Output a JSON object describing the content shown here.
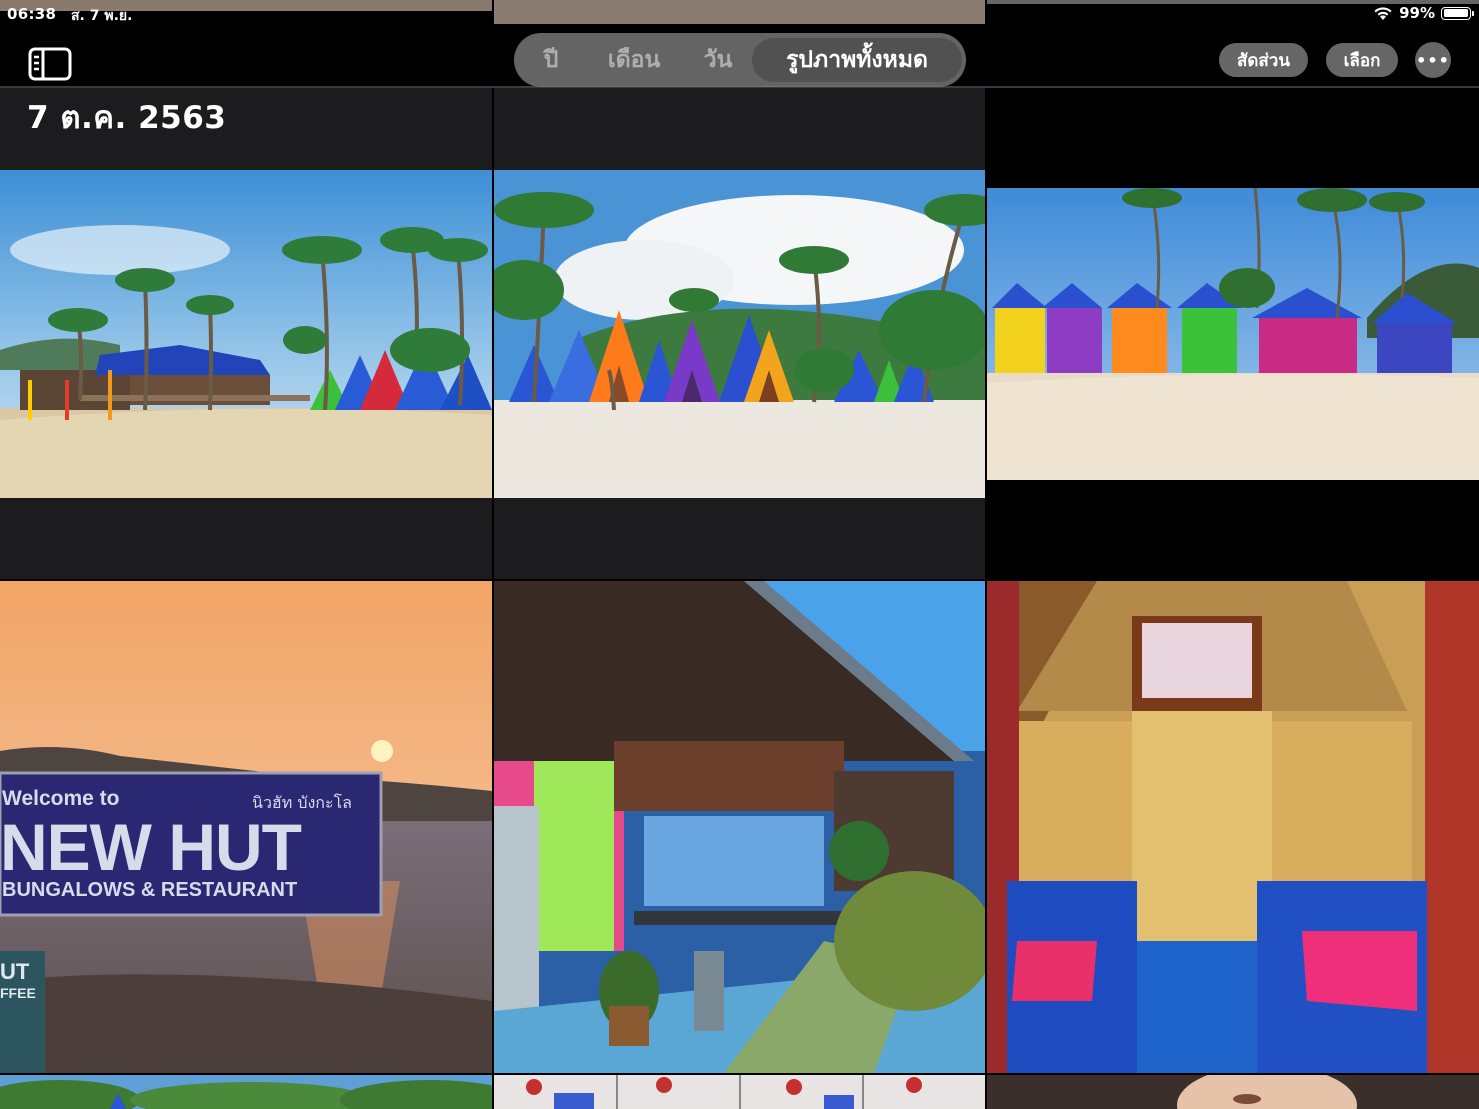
{
  "status_bar": {
    "time": "06:38",
    "date": "ส. 7 พ.ย.",
    "battery": "99%"
  },
  "toolbar": {
    "segments": [
      "ปี",
      "เดือน",
      "วัน",
      "รูปภาพทั้งหมด"
    ],
    "active_segment": "รูปภาพทั้งหมด",
    "aspect_label": "สัดส่วน",
    "select_label": "เลือก",
    "more_label": "•••"
  },
  "section": {
    "date_header": "7 ต.ค. 2563"
  },
  "sign": {
    "welcome": "Welcome to",
    "thai": "นิวฮัท บังกะโล",
    "name": "NEW HUT",
    "subtitle": "BUNGALOWS & RESTAURANT",
    "small": "UT",
    "small2": "FFEE"
  },
  "colors": {
    "accent_bg": "#000000",
    "segment_bg": "#808080",
    "tile_bg": "#1c1c1e"
  },
  "icons": {
    "sidebar": "sidebar-toggle-icon",
    "wifi": "wifi-icon",
    "battery": "battery-icon",
    "more": "ellipsis-icon"
  }
}
